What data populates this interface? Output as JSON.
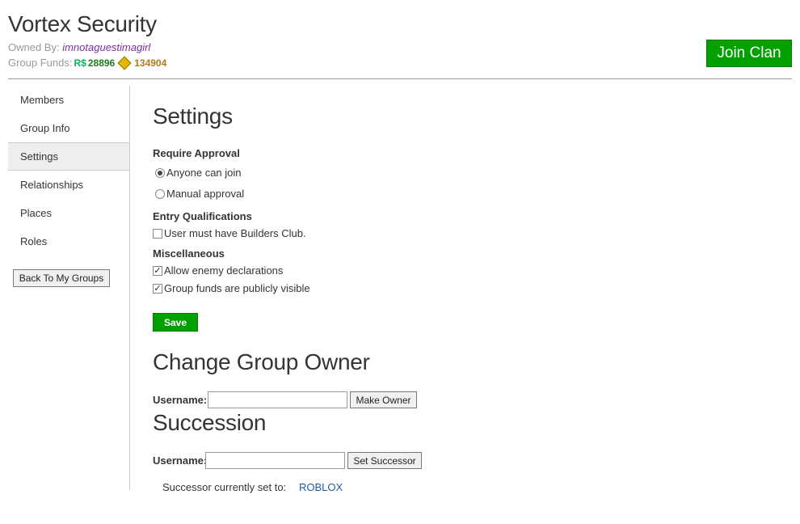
{
  "group": {
    "name": "Vortex Security",
    "owned_by_label": "Owned By:",
    "owner": "imnotaguestimagirl",
    "funds_label": "Group Funds:",
    "robux_symbol": "R$",
    "robux": "28896",
    "tix": "134904",
    "join_label": "Join Clan"
  },
  "sidebar": {
    "items": [
      {
        "label": "Members"
      },
      {
        "label": "Group Info"
      },
      {
        "label": "Settings"
      },
      {
        "label": "Relationships"
      },
      {
        "label": "Places"
      },
      {
        "label": "Roles"
      }
    ],
    "active": "Settings",
    "back_label": "Back To My Groups"
  },
  "settings": {
    "title": "Settings",
    "require_approval_label": "Require Approval",
    "anyone_label": "Anyone can join",
    "manual_label": "Manual approval",
    "selected_approval": "Anyone can join",
    "entry_label": "Entry Qualifications",
    "builders_label": "User must have Builders Club.",
    "builders_checked": false,
    "misc_label": "Miscellaneous",
    "enemy_label": "Allow enemy declarations",
    "enemy_checked": true,
    "funds_visible_label": "Group funds are publicly visible",
    "funds_visible_checked": true,
    "save_label": "Save"
  },
  "change_owner": {
    "title": "Change Group Owner",
    "username_label": "Username:",
    "username_value": "",
    "button_label": "Make Owner"
  },
  "succession": {
    "title": "Succession",
    "username_label": "Username:",
    "username_value": "",
    "button_label": "Set Successor",
    "current_label": "Successor currently set to:",
    "current_value": "ROBLOX"
  },
  "colors": {
    "accent_green": "#02a100",
    "link_blue": "#1e5ba7",
    "owner_purple": "#7b2fa3"
  }
}
